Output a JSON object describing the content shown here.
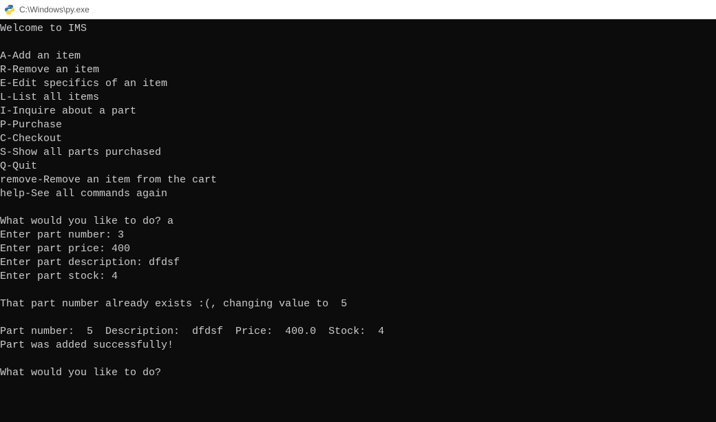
{
  "titlebar": {
    "path": "C:\\Windows\\py.exe"
  },
  "terminal": {
    "lines": [
      "Welcome to IMS",
      "",
      "A-Add an item",
      "R-Remove an item",
      "E-Edit specifics of an item",
      "L-List all items",
      "I-Inquire about a part",
      "P-Purchase",
      "C-Checkout",
      "S-Show all parts purchased",
      "Q-Quit",
      "remove-Remove an item from the cart",
      "help-See all commands again",
      "",
      "What would you like to do? a",
      "Enter part number: 3",
      "Enter part price: 400",
      "Enter part description: dfdsf",
      "Enter part stock: 4",
      "",
      "That part number already exists :(, changing value to  5",
      "",
      "Part number:  5  Description:  dfdsf  Price:  400.0  Stock:  4",
      "Part was added successfully!",
      "",
      "What would you like to do?"
    ]
  }
}
